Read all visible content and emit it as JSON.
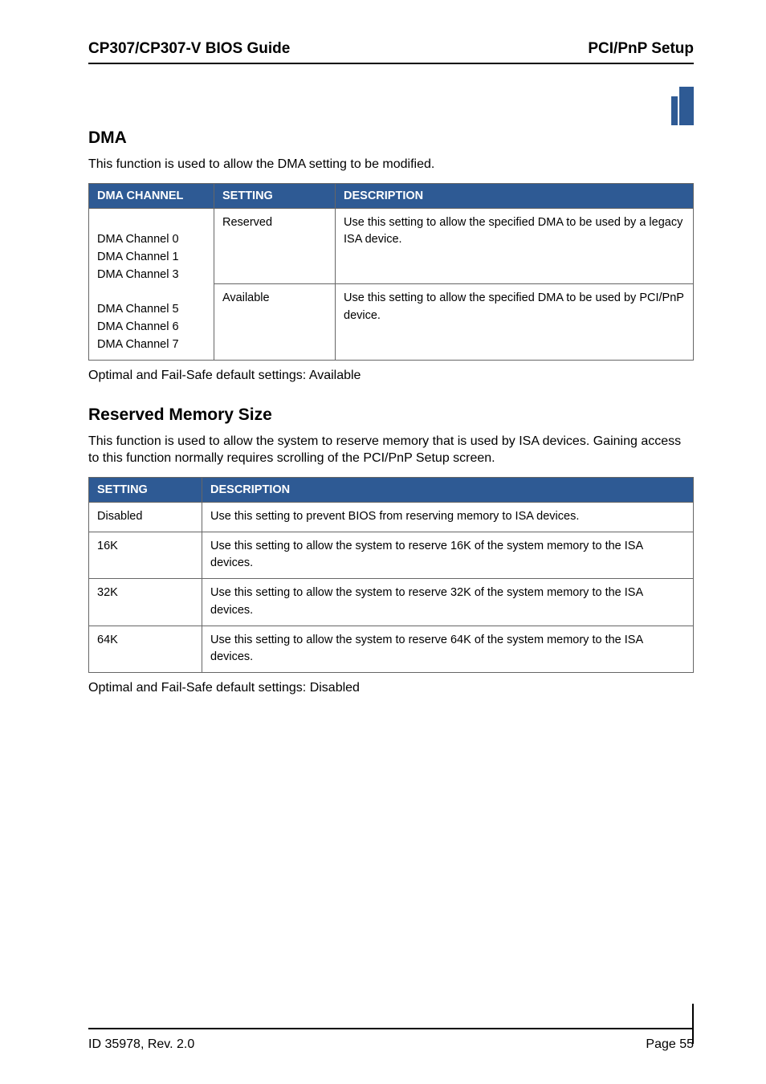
{
  "header": {
    "left": "CP307/CP307-V BIOS Guide",
    "right": "PCI/PnP Setup"
  },
  "section1": {
    "title": "DMA",
    "intro": "This function is used to allow the DMA setting to be modified.",
    "table": {
      "headers": [
        "DMA CHANNEL",
        "SETTING",
        "DESCRIPTION"
      ],
      "rows": [
        {
          "channels": "DMA Channel 0\nDMA Channel 1\nDMA Channel 3",
          "setting": "Reserved",
          "desc": "Use this setting to allow the specified DMA to be used by a legacy ISA device."
        },
        {
          "channels_hidden": "DMA Channel 5\nDMA Channel 6\nDMA Channel 7",
          "setting": "Available",
          "desc": "Use this setting to allow the specified DMA to be used by PCI/PnP device."
        }
      ]
    },
    "after": "Optimal and Fail-Safe default settings: Available"
  },
  "section2": {
    "title": "Reserved Memory Size",
    "intro": "This function is used to allow the system to reserve memory that is used by ISA devices. Gaining access to this function normally requires scrolling of the PCI/PnP Setup screen.",
    "table": {
      "headers": [
        "SETTING",
        "DESCRIPTION"
      ],
      "rows": [
        {
          "setting": "Disabled",
          "desc": "Use this setting to prevent BIOS from reserving memory to ISA devices."
        },
        {
          "setting": "16K",
          "desc": "Use this setting to allow the system to reserve 16K of the system memory to the ISA devices."
        },
        {
          "setting": "32K",
          "desc": "Use this setting to allow the system to reserve 32K of the system memory to the ISA devices."
        },
        {
          "setting": "64K",
          "desc": "Use this setting to allow the system to reserve 64K of the system memory to the ISA devices."
        }
      ]
    },
    "after": "Optimal and Fail-Safe default settings: Disabled"
  },
  "footer": {
    "left": "ID 35978, Rev. 2.0",
    "right": "Page 55"
  }
}
